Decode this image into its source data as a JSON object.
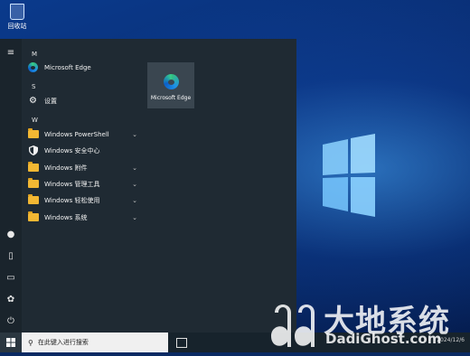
{
  "desktop": {
    "recycle_bin_label": "回收站"
  },
  "start_menu": {
    "sections": [
      {
        "letter": "M"
      },
      {
        "letter": "S"
      },
      {
        "letter": "W"
      }
    ],
    "apps": [
      {
        "label": "Microsoft Edge",
        "icon": "edge-icon"
      },
      {
        "label": "设置",
        "icon": "gear-icon"
      },
      {
        "label": "Windows PowerShell",
        "icon": "folder-icon",
        "expandable": true
      },
      {
        "label": "Windows 安全中心",
        "icon": "shield-icon"
      },
      {
        "label": "Windows 附件",
        "icon": "folder-icon",
        "expandable": true
      },
      {
        "label": "Windows 管理工具",
        "icon": "folder-icon",
        "expandable": true
      },
      {
        "label": "Windows 轻松使用",
        "icon": "folder-icon",
        "expandable": true
      },
      {
        "label": "Windows 系统",
        "icon": "folder-icon",
        "expandable": true
      }
    ],
    "tile": {
      "label": "Microsoft Edge",
      "icon": "edge-icon"
    },
    "rail_icons": [
      "hamburger-icon",
      "user-icon",
      "document-icon",
      "pictures-icon",
      "settings-icon",
      "power-icon"
    ]
  },
  "taskbar": {
    "search_placeholder": "在此键入进行搜索",
    "clock": "2024/12/6"
  },
  "watermark": {
    "cn": "大地系统",
    "en": "DadiGhost.com"
  },
  "colors": {
    "menu_bg": "#1f2a33",
    "folder": "#f2b733",
    "accent_blue": "#1e90e6"
  }
}
